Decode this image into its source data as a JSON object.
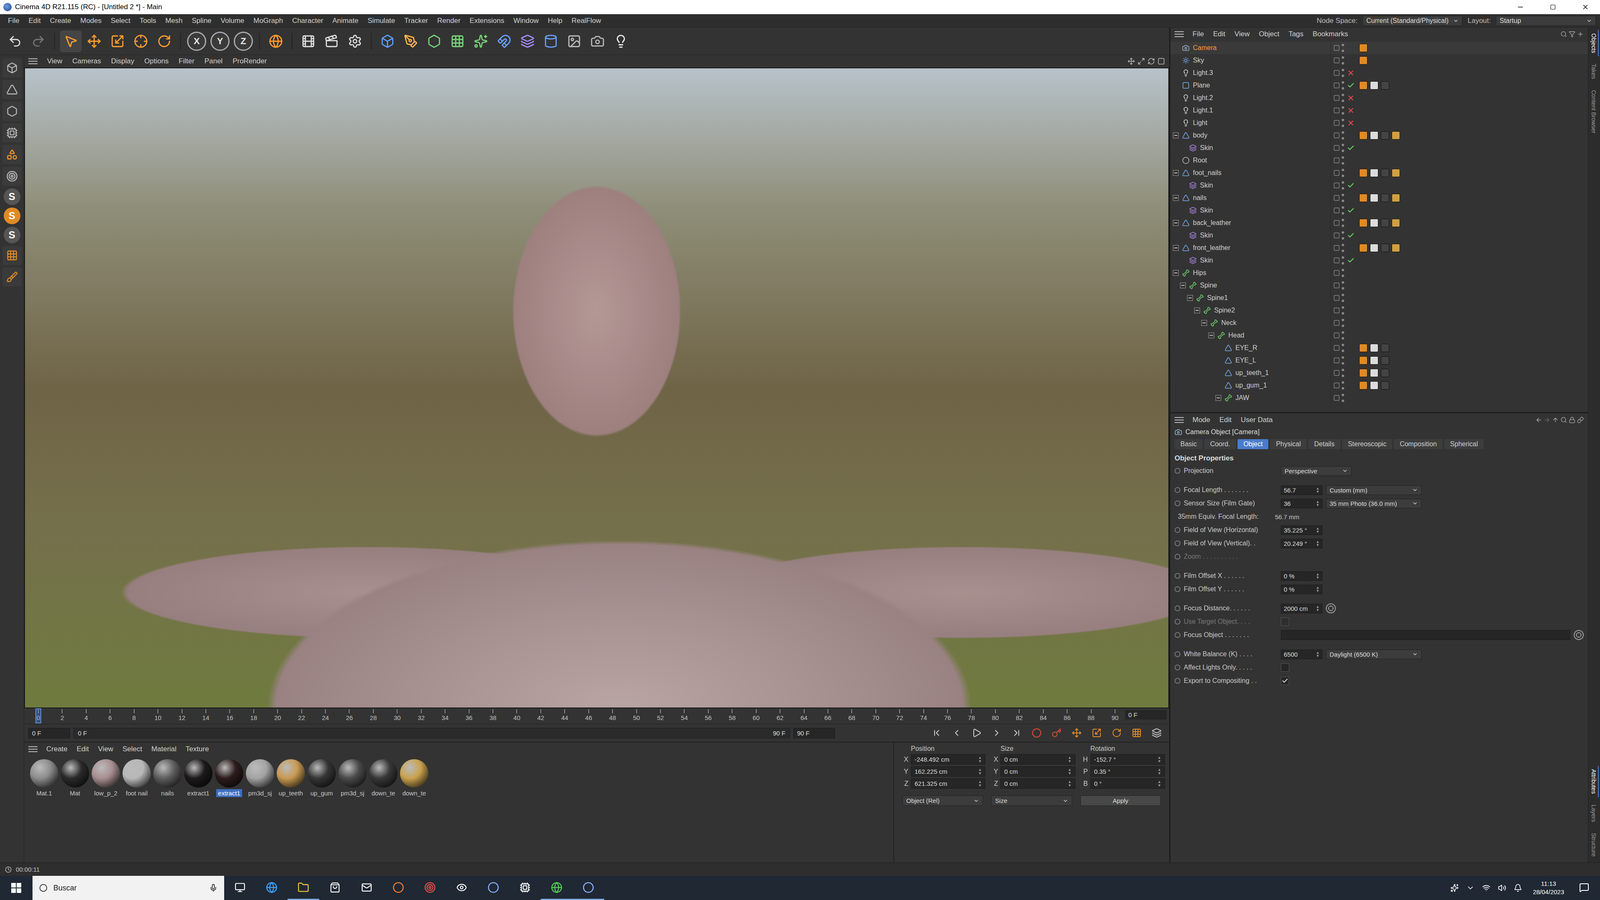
{
  "window": {
    "title": "Cinema 4D R21.115 (RC) - [Untitled 2 *] - Main"
  },
  "menu": [
    "File",
    "Edit",
    "Create",
    "Modes",
    "Select",
    "Tools",
    "Mesh",
    "Spline",
    "Volume",
    "MoGraph",
    "Character",
    "Animate",
    "Simulate",
    "Tracker",
    "Render",
    "Extensions",
    "Window",
    "Help",
    "RealFlow"
  ],
  "node_space": {
    "label": "Node Space:",
    "value": "Current (Standard/Physical)"
  },
  "layout": {
    "label": "Layout:",
    "value": "Startup"
  },
  "toolbar": {
    "axes": [
      "X",
      "Y",
      "Z"
    ]
  },
  "left_toolbar": {
    "letters": [
      "S",
      "S",
      "S"
    ]
  },
  "viewport": {
    "menu": [
      "View",
      "Cameras",
      "Display",
      "Options",
      "Filter",
      "Panel",
      "ProRender"
    ]
  },
  "timeline": {
    "ticks": [
      "0",
      "2",
      "4",
      "6",
      "8",
      "10",
      "12",
      "14",
      "16",
      "18",
      "20",
      "22",
      "24",
      "26",
      "28",
      "30",
      "32",
      "34",
      "36",
      "38",
      "40",
      "42",
      "44",
      "46",
      "48",
      "50",
      "52",
      "54",
      "56",
      "58",
      "60",
      "62",
      "64",
      "66",
      "68",
      "70",
      "72",
      "74",
      "76",
      "78",
      "80",
      "82",
      "84",
      "86",
      "88",
      "90"
    ],
    "frame_display": "0 F",
    "level": 0,
    "start": "0 F",
    "range_start": "0 F",
    "range_end": "90 F",
    "end": "90 F"
  },
  "materials": {
    "menu": [
      "Create",
      "Edit",
      "View",
      "Select",
      "Material",
      "Texture"
    ],
    "items": [
      {
        "name": "Mat.1",
        "selected": false,
        "color": "#8c8c8c"
      },
      {
        "name": "Mat",
        "selected": false,
        "color": "#2a2a2a"
      },
      {
        "name": "low_p_2",
        "selected": false,
        "color": "#a88e90"
      },
      {
        "name": "foot nail",
        "selected": false,
        "color": "#b8b8b8"
      },
      {
        "name": "nails",
        "selected": false,
        "color": "#5e5e5e"
      },
      {
        "name": "extract1",
        "selected": false,
        "color": "#1c1a1a"
      },
      {
        "name": "extract1",
        "selected": true,
        "color": "#2c1c1c"
      },
      {
        "name": "pm3d_sj",
        "selected": false,
        "color": "#a4a4a4"
      },
      {
        "name": "up_teeth",
        "selected": false,
        "color": "#c89a52"
      },
      {
        "name": "up_gum",
        "selected": false,
        "color": "#353535"
      },
      {
        "name": "pm3d_sj",
        "selected": false,
        "color": "#4a4a4a"
      },
      {
        "name": "down_te",
        "selected": false,
        "color": "#383838"
      },
      {
        "name": "down_te",
        "selected": false,
        "color": "#c9a24e"
      }
    ]
  },
  "coordinates": {
    "headers": [
      "Position",
      "Size",
      "Rotation"
    ],
    "rows": [
      {
        "pos_axis": "X",
        "position": "-248.492 cm",
        "size_axis": "X",
        "size": "0 cm",
        "rot_axis": "H",
        "rotation": "-152.7 °"
      },
      {
        "pos_axis": "Y",
        "position": "162.225 cm",
        "size_axis": "Y",
        "size": "0 cm",
        "rot_axis": "P",
        "rotation": "0.35 °"
      },
      {
        "pos_axis": "Z",
        "position": "621.325 cm",
        "size_axis": "Z",
        "size": "0 cm",
        "rot_axis": "B",
        "rotation": "0 °"
      }
    ],
    "mode": "Object (Rel)",
    "size_mode": "Size",
    "apply": "Apply"
  },
  "status_bar": {
    "time": "00:00:11"
  },
  "object_manager": {
    "menu": [
      "File",
      "Edit",
      "View",
      "Object",
      "Tags",
      "Bookmarks"
    ],
    "objects": [
      {
        "name": "Camera",
        "kind": "camera",
        "depth": 0,
        "expanded": false,
        "selected": true,
        "flag": "none",
        "tags": 1
      },
      {
        "name": "Sky",
        "kind": "sky",
        "depth": 0,
        "expanded": false,
        "selected": false,
        "flag": "none",
        "tags": 1
      },
      {
        "name": "Light.3",
        "kind": "light",
        "depth": 0,
        "expanded": false,
        "selected": false,
        "flag": "off",
        "tags": 0
      },
      {
        "name": "Plane",
        "kind": "plane",
        "depth": 0,
        "expanded": false,
        "selected": false,
        "flag": "on",
        "tags": 3
      },
      {
        "name": "Light.2",
        "kind": "light",
        "depth": 0,
        "expanded": false,
        "selected": false,
        "flag": "off",
        "tags": 0
      },
      {
        "name": "Light.1",
        "kind": "light",
        "depth": 0,
        "expanded": false,
        "selected": false,
        "flag": "off",
        "tags": 0
      },
      {
        "name": "Light",
        "kind": "light",
        "depth": 0,
        "expanded": false,
        "selected": false,
        "flag": "off",
        "tags": 0
      },
      {
        "name": "body",
        "kind": "mesh",
        "depth": 0,
        "expanded": true,
        "selected": false,
        "flag": "none",
        "tags": 4
      },
      {
        "name": "Skin",
        "kind": "skin",
        "depth": 1,
        "expanded": false,
        "selected": false,
        "flag": "on",
        "tags": 0
      },
      {
        "name": "Root",
        "kind": "null",
        "depth": 0,
        "expanded": false,
        "selected": false,
        "flag": "none",
        "tags": 0
      },
      {
        "name": "foot_nails",
        "kind": "mesh",
        "depth": 0,
        "expanded": true,
        "selected": false,
        "flag": "none",
        "tags": 4
      },
      {
        "name": "Skin",
        "kind": "skin",
        "depth": 1,
        "expanded": false,
        "selected": false,
        "flag": "on",
        "tags": 0
      },
      {
        "name": "nails",
        "kind": "mesh",
        "depth": 0,
        "expanded": true,
        "selected": false,
        "flag": "none",
        "tags": 4
      },
      {
        "name": "Skin",
        "kind": "skin",
        "depth": 1,
        "expanded": false,
        "selected": false,
        "flag": "on",
        "tags": 0
      },
      {
        "name": "back_leather",
        "kind": "mesh",
        "depth": 0,
        "expanded": true,
        "selected": false,
        "flag": "none",
        "tags": 4
      },
      {
        "name": "Skin",
        "kind": "skin",
        "depth": 1,
        "expanded": false,
        "selected": false,
        "flag": "on",
        "tags": 0
      },
      {
        "name": "front_leather",
        "kind": "mesh",
        "depth": 0,
        "expanded": true,
        "selected": false,
        "flag": "none",
        "tags": 4
      },
      {
        "name": "Skin",
        "kind": "skin",
        "depth": 1,
        "expanded": false,
        "selected": false,
        "flag": "on",
        "tags": 0
      },
      {
        "name": "Hips",
        "kind": "joint",
        "depth": 0,
        "expanded": true,
        "selected": false,
        "flag": "none",
        "tags": 0
      },
      {
        "name": "Spine",
        "kind": "joint",
        "depth": 1,
        "expanded": true,
        "selected": false,
        "flag": "none",
        "tags": 0
      },
      {
        "name": "Spine1",
        "kind": "joint",
        "depth": 2,
        "expanded": true,
        "selected": false,
        "flag": "none",
        "tags": 0
      },
      {
        "name": "Spine2",
        "kind": "joint",
        "depth": 3,
        "expanded": true,
        "selected": false,
        "flag": "none",
        "tags": 0
      },
      {
        "name": "Neck",
        "kind": "joint",
        "depth": 4,
        "expanded": true,
        "selected": false,
        "flag": "none",
        "tags": 0
      },
      {
        "name": "Head",
        "kind": "joint",
        "depth": 5,
        "expanded": true,
        "selected": false,
        "flag": "none",
        "tags": 0
      },
      {
        "name": "EYE_R",
        "kind": "mesh",
        "depth": 6,
        "expanded": false,
        "selected": false,
        "flag": "none",
        "tags": 3
      },
      {
        "name": "EYE_L",
        "kind": "mesh",
        "depth": 6,
        "expanded": false,
        "selected": false,
        "flag": "none",
        "tags": 3
      },
      {
        "name": "up_teeth_1",
        "kind": "mesh",
        "depth": 6,
        "expanded": false,
        "selected": false,
        "flag": "none",
        "tags": 3
      },
      {
        "name": "up_gum_1",
        "kind": "mesh",
        "depth": 6,
        "expanded": false,
        "selected": false,
        "flag": "none",
        "tags": 3
      },
      {
        "name": "JAW",
        "kind": "joint",
        "depth": 6,
        "expanded": true,
        "selected": false,
        "flag": "none",
        "tags": 0
      }
    ]
  },
  "attributes": {
    "menu": [
      "Mode",
      "Edit",
      "User Data"
    ],
    "title": "Camera Object [Camera]",
    "tabs": [
      {
        "label": "Basic",
        "selected": false
      },
      {
        "label": "Coord.",
        "selected": false
      },
      {
        "label": "Object",
        "selected": true
      },
      {
        "label": "Physical",
        "selected": false
      },
      {
        "label": "Details",
        "selected": false
      },
      {
        "label": "Stereoscopic",
        "selected": false
      },
      {
        "label": "Composition",
        "selected": false
      },
      {
        "label": "Spherical",
        "selected": false
      }
    ],
    "section": "Object Properties",
    "groups": [
      [
        {
          "kind": "dropdown",
          "label": "Projection",
          "value": "Perspective"
        }
      ],
      [
        {
          "kind": "number_dropdown",
          "label": "Focal Length . . . . . . .",
          "value": "56.7",
          "option": "Custom (mm)"
        },
        {
          "kind": "number_dropdown",
          "label": "Sensor Size (Film Gate)",
          "value": "36",
          "option": "35 mm Photo (36.0 mm)"
        },
        {
          "kind": "text",
          "label": "35mm Equiv. Focal Length:",
          "value": "56.7 mm"
        },
        {
          "kind": "number",
          "label": "Field of View (Horizontal)",
          "value": "35.225 °"
        },
        {
          "kind": "number",
          "label": "Field of View (Vertical). .",
          "value": "20.249 °"
        },
        {
          "kind": "disabled",
          "label": "Zoom . . . . . . . . . ."
        }
      ],
      [
        {
          "kind": "number",
          "label": "Film Offset X . . . . . .",
          "value": "0 %"
        },
        {
          "kind": "number",
          "label": "Film Offset Y . . . . . .",
          "value": "0 %"
        }
      ],
      [
        {
          "kind": "number_picker",
          "label": "Focus Distance. . . . . .",
          "value": "2000 cm"
        },
        {
          "kind": "checkbox",
          "label": "Use Target Object. . . .",
          "checked": false,
          "disabled": true
        },
        {
          "kind": "link",
          "label": "Focus Object . . . . . . ."
        }
      ],
      [
        {
          "kind": "number_dropdown",
          "label": "White Balance (K) . . . .",
          "value": "6500",
          "option": "Daylight (6500 K)"
        },
        {
          "kind": "checkbox",
          "label": "Affect Lights Only. . . . .",
          "checked": false,
          "disabled": false
        },
        {
          "kind": "checkbox",
          "label": "Export to Compositing . .",
          "checked": true,
          "disabled": false
        }
      ]
    ]
  },
  "side_tabs": {
    "top": [
      {
        "label": "Objects",
        "selected": true
      },
      {
        "label": "Takes",
        "selected": false
      },
      {
        "label": "Content Browser",
        "selected": false
      }
    ],
    "bottom": [
      {
        "label": "Attributes",
        "selected": true
      },
      {
        "label": "Layers",
        "selected": false
      },
      {
        "label": "Structure",
        "selected": false
      }
    ]
  },
  "taskbar": {
    "search": "Buscar",
    "time": "11:13",
    "date": "28/04/2023"
  }
}
